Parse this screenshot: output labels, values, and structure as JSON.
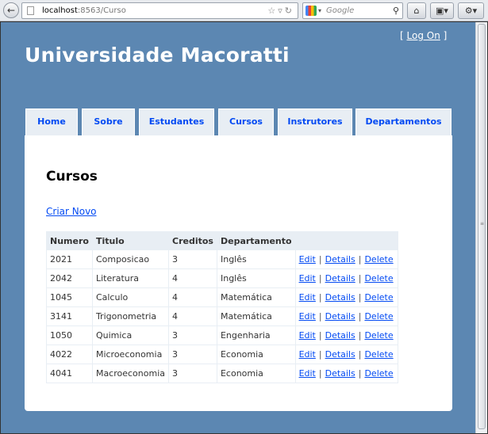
{
  "browser": {
    "url_host": "localhost",
    "url_rest": ":8563/Curso",
    "search_placeholder": "Google"
  },
  "header": {
    "title": "Universidade Macoratti",
    "login_open": "[ ",
    "login_link": "Log On",
    "login_close": " ]"
  },
  "menu": [
    {
      "label": "Home"
    },
    {
      "label": "Sobre"
    },
    {
      "label": "Estudantes"
    },
    {
      "label": "Cursos"
    },
    {
      "label": "Instrutores"
    },
    {
      "label": "Departamentos"
    }
  ],
  "content": {
    "heading": "Cursos",
    "create_link": "Criar Novo",
    "columns": [
      "Numero",
      "Titulo",
      "Creditos",
      "Departamento"
    ],
    "actions": {
      "edit": "Edit",
      "details": "Details",
      "delete": "Delete",
      "separator": "|"
    },
    "rows": [
      {
        "numero": "2021",
        "titulo": "Composicao",
        "creditos": "3",
        "departamento": "Inglês"
      },
      {
        "numero": "2042",
        "titulo": "Literatura",
        "creditos": "4",
        "departamento": "Inglês"
      },
      {
        "numero": "1045",
        "titulo": "Calculo",
        "creditos": "4",
        "departamento": "Matemática"
      },
      {
        "numero": "3141",
        "titulo": "Trigonometria",
        "creditos": "4",
        "departamento": "Matemática"
      },
      {
        "numero": "1050",
        "titulo": "Quimica",
        "creditos": "3",
        "departamento": "Engenharia"
      },
      {
        "numero": "4022",
        "titulo": "Microeconomia",
        "creditos": "3",
        "departamento": "Economia"
      },
      {
        "numero": "4041",
        "titulo": "Macroeconomia",
        "creditos": "3",
        "departamento": "Economia"
      }
    ]
  },
  "colors": {
    "page_background": "#5c87b2",
    "tab_background": "#e8eef4",
    "link": "#034af3"
  }
}
